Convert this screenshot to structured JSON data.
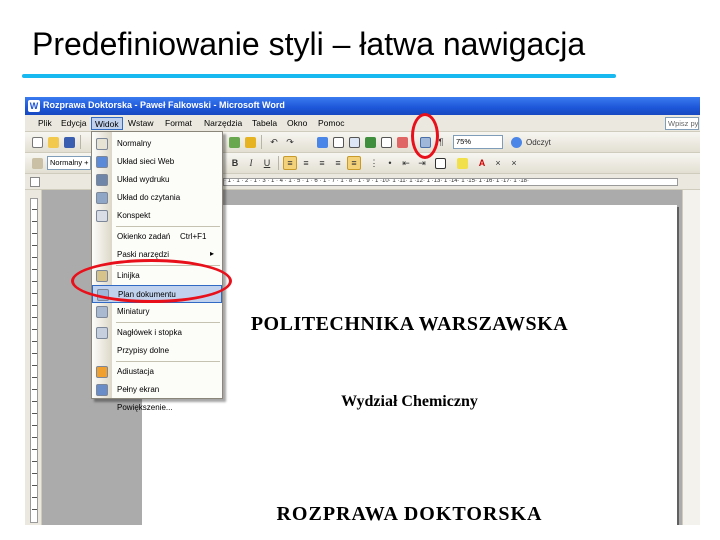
{
  "slide": {
    "title": "Predefiniowanie styli – łatwa nawigacja",
    "accent_color": "#18b8f0",
    "annotation_color": "#e8101a"
  },
  "window": {
    "title": "Rozprawa Doktorska - Paweł Falkowski - Microsoft Word",
    "app_icon": "word-icon"
  },
  "menubar": {
    "items": [
      "Plik",
      "Edycja",
      "Widok",
      "Wstaw",
      "Format",
      "Narzędzia",
      "Tabela",
      "Okno",
      "Pomoc"
    ],
    "active": "Widok",
    "help_placeholder": "Wpisz pyt"
  },
  "toolbar": {
    "zoom": "75%",
    "read_label": "Odczyt",
    "style_combo": "Normalny + ",
    "bold": "B",
    "italic": "I",
    "underline": "U"
  },
  "ruler": {
    "marks": "· 1 · 1 · 2 · 1 · 3 · 1 · 4 · 1 · 5 · 1 · 6 · 1 · 7 · 1 · 8 · 1 · 9 · 1 ·10· 1 ·11· 1 ·12· 1 ·13· 1 ·14· 1 ·15· 1 ·16· 1 ·17· 1 ·18·"
  },
  "view_menu": {
    "items": [
      {
        "label": "Normalny",
        "icon": "normal-view-icon"
      },
      {
        "label": "Układ sieci Web",
        "icon": "web-layout-icon"
      },
      {
        "label": "Układ wydruku",
        "icon": "print-layout-icon"
      },
      {
        "label": "Układ do czytania",
        "icon": "reading-layout-icon"
      },
      {
        "label": "Konspekt",
        "icon": "outline-icon"
      },
      {
        "label": "Okienko zadań",
        "shortcut": "Ctrl+F1",
        "icon": ""
      },
      {
        "label": "Paski narzędzi",
        "submenu": "▸",
        "icon": ""
      },
      {
        "label": "Linijka",
        "icon": "ruler-icon"
      },
      {
        "label": "Plan dokumentu",
        "icon": "document-map-icon",
        "highlighted": true
      },
      {
        "label": "Miniatury",
        "icon": "thumbnails-icon"
      },
      {
        "label": "Nagłówek i stopka",
        "icon": "header-footer-icon"
      },
      {
        "label": "Przypisy dolne",
        "icon": ""
      },
      {
        "label": "Adiustacja",
        "icon": "markup-icon"
      },
      {
        "label": "Pełny ekran",
        "icon": "full-screen-icon"
      },
      {
        "label": "Powiększenie...",
        "icon": ""
      }
    ]
  },
  "document": {
    "university": "POLITECHNIKA WARSZAWSKA",
    "faculty": "Wydział Chemiczny",
    "thesis": "ROZPRAWA DOKTORSKA"
  }
}
